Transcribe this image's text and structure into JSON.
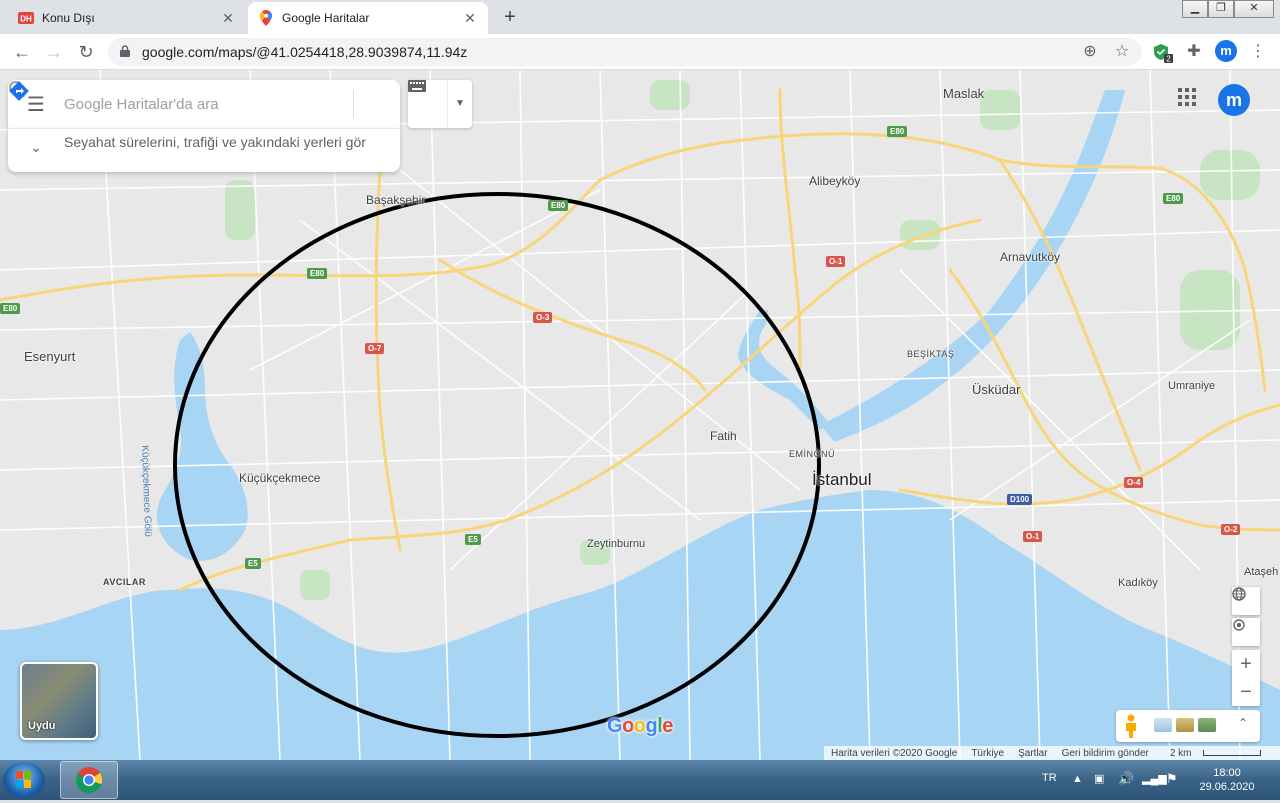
{
  "browser": {
    "tabs": [
      {
        "title": "Konu Dışı",
        "active": false
      },
      {
        "title": "Google Haritalar",
        "active": true
      }
    ],
    "url": "google.com/maps/@41.0254418,28.9039874,11.94z",
    "profile_initial": "m",
    "extension_badge": "2"
  },
  "maps": {
    "search_placeholder": "Google Haritalar'da ara",
    "suggestion": "Seyahat sürelerini, trafiği ve yakındaki yerleri gör",
    "profile_initial": "m",
    "satellite_label": "Uydu",
    "logo": "Google",
    "footer": {
      "data": "Harita verileri ©2020 Google",
      "country": "Türkiye",
      "terms": "Şartlar",
      "feedback": "Geri bildirim gönder",
      "scale": "2 km"
    },
    "places": {
      "maslak": "Maslak",
      "alibeykoy": "Alibeyköy",
      "basaksehir": "Başakşehir",
      "arnavutkoy": "Arnavutköy",
      "esenyurt": "Esenyurt",
      "besiktas": "BEŞİKTAŞ",
      "uskudar": "Üsküdar",
      "umraniye": "Umraniye",
      "fatih": "Fatih",
      "eminonu": "EMİNÖNÜ",
      "istanbul": "İstanbul",
      "kucukcekmece": "Küçükçekmece",
      "kucukcekmece_lake": "Küçükçekmece Gölü",
      "zeytinburnu": "Zeytinburnu",
      "avcilar": "AVCILAR",
      "kadikoy": "Kadıköy",
      "atasehir": "Ataşeh"
    },
    "road_shields": {
      "e80": "E80",
      "e5": "E5",
      "o1": "O-1",
      "o2": "O-2",
      "o3": "O-3",
      "o4": "O-4",
      "o7": "O-7",
      "d100": "D100"
    }
  },
  "taskbar": {
    "language": "TR",
    "time": "18:00",
    "date": "29.06.2020"
  }
}
